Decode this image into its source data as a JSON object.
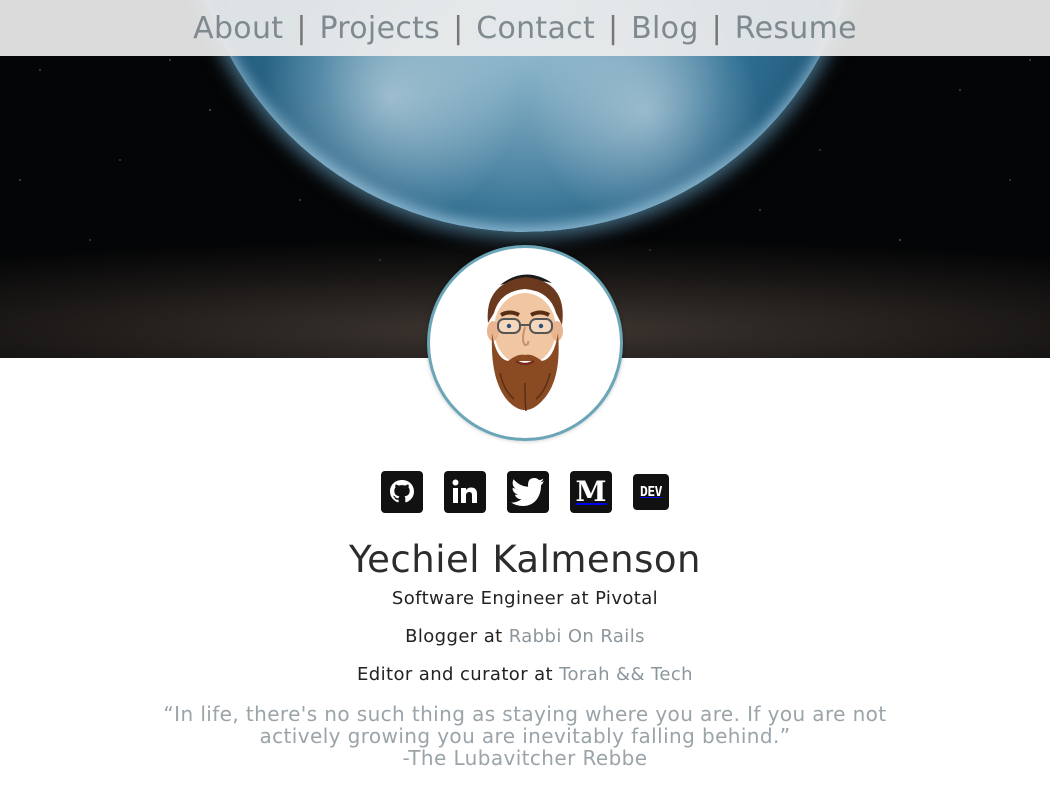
{
  "nav": {
    "items": [
      "About",
      "Projects",
      "Contact",
      "Blog",
      "Resume"
    ],
    "separator": "|"
  },
  "social": {
    "icons": [
      "github-icon",
      "linkedin-icon",
      "twitter-icon",
      "medium-icon",
      "dev-icon"
    ],
    "medium_letter": "M",
    "dev_text": "DEV"
  },
  "profile": {
    "name": "Yechiel Kalmenson",
    "role": "Software Engineer at Pivotal",
    "blogger_prefix": "Blogger at",
    "blogger_link": "Rabbi On Rails",
    "editor_prefix": "Editor and curator at",
    "editor_link": "Torah && Tech"
  },
  "quote": {
    "text": "“In life, there's no such thing as staying where you are. If you are not actively growing you are inevitably falling behind.”",
    "author": "-The Lubavitcher Rebbe"
  },
  "colors": {
    "link": "#8b969c",
    "nav_text": "#7f8a90",
    "avatar_border": "#6aa6b8"
  }
}
